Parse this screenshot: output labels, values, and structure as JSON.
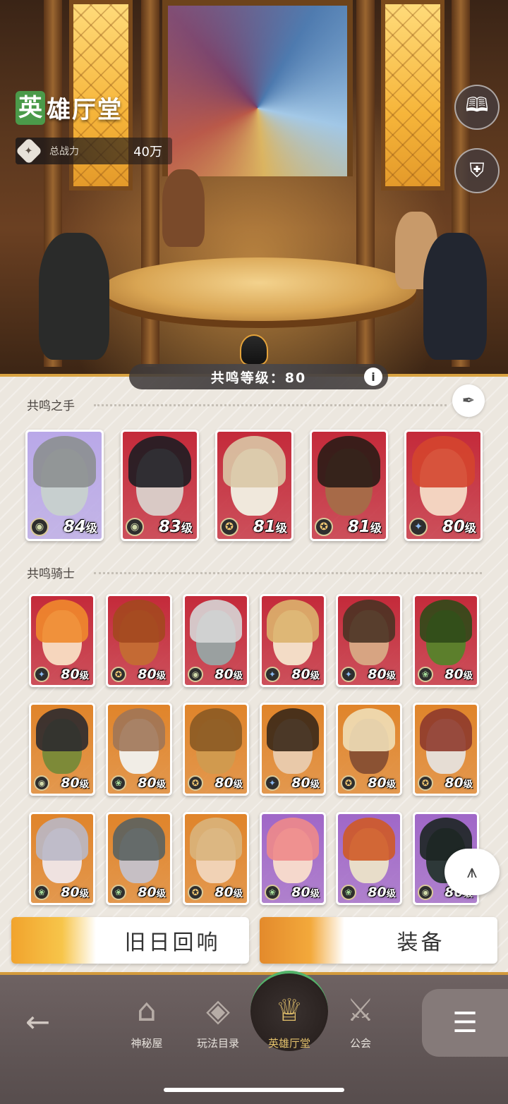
{
  "header": {
    "title_first": "英",
    "title_rest": "雄厅堂",
    "power_label": "总战力",
    "power_value": "40万"
  },
  "side_buttons": [
    "book-icon",
    "helmet-icon"
  ],
  "resonance": {
    "label": "共鸣等级：80",
    "info": "i"
  },
  "hands": {
    "title": "共鸣之手",
    "cards": [
      {
        "level": "84",
        "unit": "级",
        "faction": "forest",
        "bg": "#b9a8e8",
        "skin": "#c7cfcf",
        "hair": "#8c8f90"
      },
      {
        "level": "83",
        "unit": "级",
        "faction": "forest",
        "bg": "#c42a3a",
        "skin": "#d9c9c5",
        "hair": "#1d1d22"
      },
      {
        "level": "81",
        "unit": "级",
        "faction": "light",
        "bg": "#c42a3a",
        "skin": "#f0e8dc",
        "hair": "#d9c8a6"
      },
      {
        "level": "81",
        "unit": "级",
        "faction": "light",
        "bg": "#c42a3a",
        "skin": "#a76a48",
        "hair": "#2a1c16"
      },
      {
        "level": "80",
        "unit": "级",
        "faction": "star",
        "bg": "#c42a3a",
        "skin": "#f3d3c0",
        "hair": "#d4452e"
      }
    ]
  },
  "knights": {
    "title": "共鸣骑士",
    "cards": [
      {
        "level": "80",
        "unit": "级",
        "faction": "star",
        "bg": "#c42a3a",
        "skin": "#f6d6bd",
        "hair": "#ef8a2c"
      },
      {
        "level": "80",
        "unit": "级",
        "faction": "light",
        "bg": "#c42a3a",
        "skin": "#c46a34",
        "hair": "#a3481f"
      },
      {
        "level": "80",
        "unit": "级",
        "faction": "forest",
        "bg": "#c42a3a",
        "skin": "#9aa0a0",
        "hair": "#d6d6d6"
      },
      {
        "level": "80",
        "unit": "级",
        "faction": "star",
        "bg": "#c42a3a",
        "skin": "#f3dcc6",
        "hair": "#dcb36d"
      },
      {
        "level": "80",
        "unit": "级",
        "faction": "star",
        "bg": "#c42a3a",
        "skin": "#d7a482",
        "hair": "#4a3324"
      },
      {
        "level": "80",
        "unit": "级",
        "faction": "nature",
        "bg": "#c42a3a",
        "skin": "#5c7f2c",
        "hair": "#2f4a18"
      },
      {
        "level": "80",
        "unit": "级",
        "faction": "forest",
        "bg": "#e0842a",
        "skin": "#7d8a38",
        "hair": "#2c2a2f"
      },
      {
        "level": "80",
        "unit": "级",
        "faction": "nature",
        "bg": "#e0842a",
        "skin": "#f1ede6",
        "hair": "#a07658"
      },
      {
        "level": "80",
        "unit": "级",
        "faction": "light",
        "bg": "#e0842a",
        "skin": "#d19a4e",
        "hair": "#8b5a24"
      },
      {
        "level": "80",
        "unit": "级",
        "faction": "star",
        "bg": "#e0842a",
        "skin": "#e9c9a9",
        "hair": "#3a2818"
      },
      {
        "level": "80",
        "unit": "级",
        "faction": "light",
        "bg": "#e0842a",
        "skin": "#8b5233",
        "hair": "#efdfb8"
      },
      {
        "level": "80",
        "unit": "级",
        "faction": "light",
        "bg": "#e0842a",
        "skin": "#e6ddd4",
        "hair": "#8e3a2c"
      },
      {
        "level": "80",
        "unit": "级",
        "faction": "nature",
        "bg": "#e0842a",
        "skin": "#efe2e0",
        "hair": "#b9b8c6"
      },
      {
        "level": "80",
        "unit": "级",
        "faction": "nature",
        "bg": "#e0842a",
        "skin": "#c6bfc4",
        "hair": "#5a6260"
      },
      {
        "level": "80",
        "unit": "级",
        "faction": "light",
        "bg": "#e0842a",
        "skin": "#f1d2b5",
        "hair": "#d9b47c"
      },
      {
        "level": "80",
        "unit": "级",
        "faction": "nature",
        "bg": "#a067c8",
        "skin": "#f5d8cc",
        "hair": "#ee8a8a"
      },
      {
        "level": "80",
        "unit": "级",
        "faction": "nature",
        "bg": "#a067c8",
        "skin": "#e8ddc9",
        "hair": "#cf5a26"
      },
      {
        "level": "80",
        "unit": "级",
        "faction": "forest",
        "bg": "#a067c8",
        "skin": "#2d3838",
        "hair": "#1d2624"
      }
    ]
  },
  "actions": {
    "echo": "旧日回响",
    "equip": "装备"
  },
  "nav": {
    "items": [
      {
        "label": "神秘屋",
        "icon": "house-icon"
      },
      {
        "label": "玩法目录",
        "icon": "catalog-icon"
      },
      {
        "label": "英雄厅堂",
        "icon": "hero-hall-icon"
      },
      {
        "label": "公会",
        "icon": "guild-icon"
      }
    ]
  },
  "colors": {
    "accent": "#e2c06b",
    "panel": "#ece7df",
    "nav": "#5f5454"
  }
}
